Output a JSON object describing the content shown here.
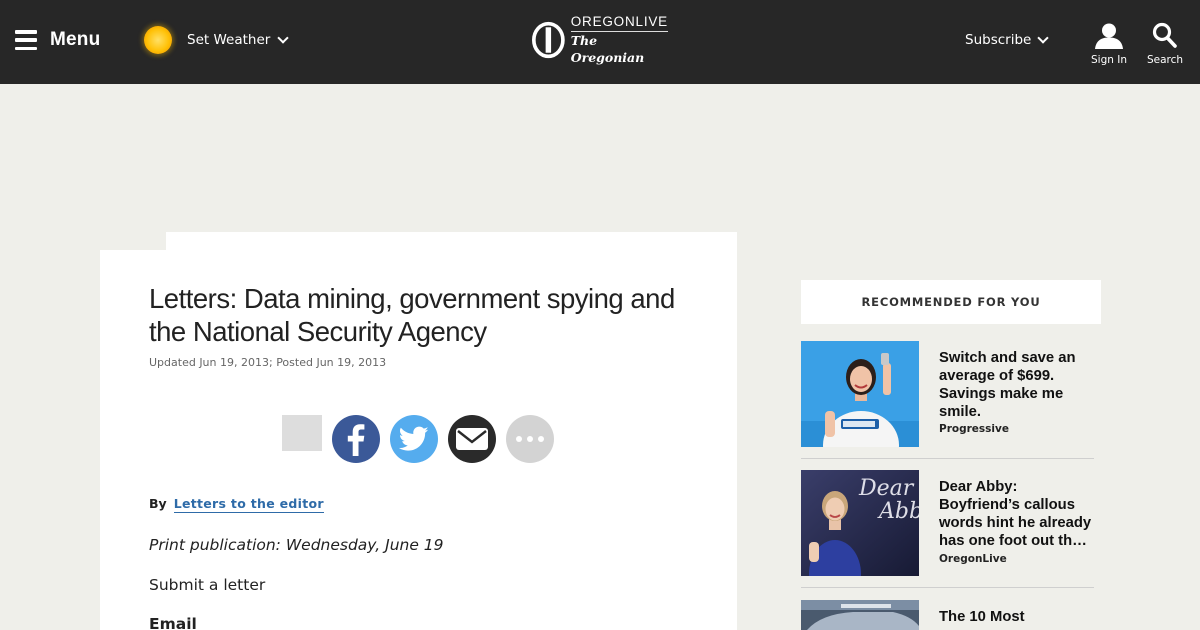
{
  "nav": {
    "menu_label": "Menu",
    "weather_label": "Set Weather",
    "logo_top": "OREGONLIVE",
    "logo_bottom": "The Oregonian",
    "subscribe_label": "Subscribe",
    "signin_label": "Sign In",
    "search_label": "Search"
  },
  "article": {
    "headline": "Letters: Data mining, government spying and the National Security Agency",
    "dates": "Updated Jun 19, 2013; Posted Jun 19, 2013",
    "byline_prefix": "By",
    "byline_author": "Letters to the editor",
    "print_publication": "Print publication: Wednesday, June 19",
    "submit_letter": "Submit a letter",
    "email_heading": "Email"
  },
  "sidebar": {
    "header": "RECOMMENDED FOR YOU",
    "items": [
      {
        "title": "Switch and save an average of $699. Savings make me smile.",
        "source": "Progressive"
      },
      {
        "title": "Dear Abby: Boyfriend’s callous words hint he already has one foot out th…",
        "source": "OregonLive"
      },
      {
        "title": "The 10 Most",
        "source": ""
      }
    ]
  },
  "colors": {
    "nav_bg": "#272727",
    "page_bg": "#efefea",
    "facebook": "#3b5998",
    "twitter": "#55acee",
    "email": "#2a2a2a",
    "more": "#d3d3d3",
    "link": "#2e6ba8"
  }
}
